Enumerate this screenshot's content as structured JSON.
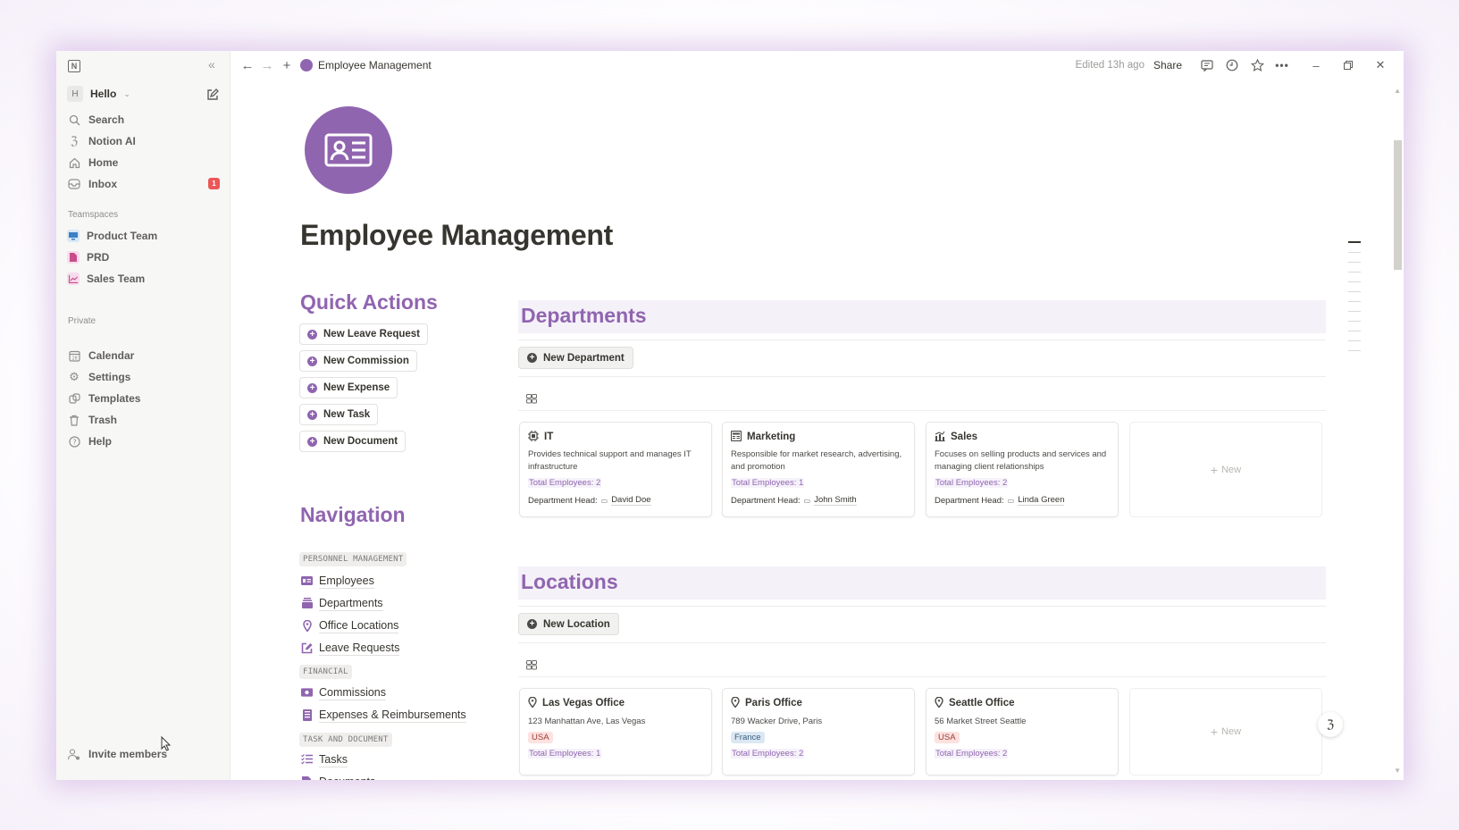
{
  "sidebar": {
    "workspace_initial": "H",
    "workspace_name": "Hello",
    "top_items": [
      {
        "label": "Search",
        "icon": "search-icon"
      },
      {
        "label": "Notion AI",
        "icon": "notion-ai-icon"
      },
      {
        "label": "Home",
        "icon": "home-icon"
      },
      {
        "label": "Inbox",
        "icon": "inbox-icon",
        "badge": "1"
      }
    ],
    "teamspaces_label": "Teamspaces",
    "teamspaces": [
      {
        "label": "Product Team",
        "icon": "monitor-icon",
        "color": "#3d7fc4"
      },
      {
        "label": "PRD",
        "icon": "document-icon",
        "color": "#c94c8a"
      },
      {
        "label": "Sales Team",
        "icon": "chart-icon",
        "color": "#c94c8a"
      }
    ],
    "private_label": "Private",
    "private_items": [
      {
        "label": "Calendar",
        "icon": "calendar-icon"
      },
      {
        "label": "Settings",
        "icon": "gear-icon"
      },
      {
        "label": "Templates",
        "icon": "templates-icon"
      },
      {
        "label": "Trash",
        "icon": "trash-icon"
      },
      {
        "label": "Help",
        "icon": "help-icon"
      }
    ],
    "invite_label": "Invite members"
  },
  "topbar": {
    "breadcrumb": "Employee Management",
    "edited": "Edited 13h ago",
    "share": "Share"
  },
  "page": {
    "title": "Employee Management",
    "icon": "contact-card-icon",
    "accent": "#9065b0"
  },
  "quick_actions": {
    "heading": "Quick Actions",
    "buttons": [
      "New Leave Request",
      "New Commission",
      "New Expense",
      "New Task",
      "New Document"
    ]
  },
  "navigation": {
    "heading": "Navigation",
    "groups": [
      {
        "tag": "PERSONNEL MANAGEMENT",
        "links": [
          "Employees",
          "Departments",
          "Office Locations",
          "Leave Requests"
        ]
      },
      {
        "tag": "FINANCIAL",
        "links": [
          "Commissions",
          "Expenses & Reimbursements"
        ]
      },
      {
        "tag": "TASK AND DOCUMENT",
        "links": [
          "Tasks",
          "Documents"
        ]
      }
    ]
  },
  "departments": {
    "heading": "Departments",
    "new_button": "New Department",
    "new_card": "New",
    "head_label": "Department Head:",
    "cards": [
      {
        "name": "IT",
        "desc": "Provides technical support and manages IT infrastructure",
        "total": "Total Employees: 2",
        "head": "David Doe"
      },
      {
        "name": "Marketing",
        "desc": "Responsible for market research, advertising, and promotion",
        "total": "Total Employees: 1",
        "head": "John Smith"
      },
      {
        "name": "Sales",
        "desc": "Focuses on selling products and services and managing client relationships",
        "total": "Total Employees: 2",
        "head": "Linda Green"
      }
    ]
  },
  "locations": {
    "heading": "Locations",
    "new_button": "New Location",
    "new_card": "New",
    "cards": [
      {
        "name": "Las Vegas Office",
        "address": "123 Manhattan Ave, Las Vegas",
        "country": "USA",
        "country_bg": "#fde2e0",
        "country_fg": "#9f3b33",
        "total": "Total Employees: 1"
      },
      {
        "name": "Paris Office",
        "address": "789 Wacker Drive, Paris",
        "country": "France",
        "country_bg": "#dbe8f3",
        "country_fg": "#3b5e80",
        "total": "Total Employees: 2"
      },
      {
        "name": "Seattle Office",
        "address": "56 Market Street Seattle",
        "country": "USA",
        "country_bg": "#fde2e0",
        "country_fg": "#9f3b33",
        "total": "Total Employees: 2"
      }
    ]
  }
}
